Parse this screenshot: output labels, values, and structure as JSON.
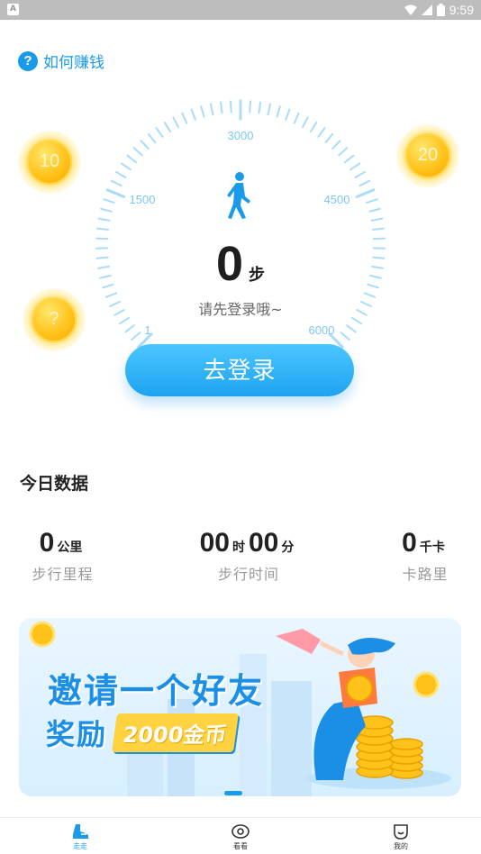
{
  "status_bar": {
    "time": "9:59",
    "notification_icon": "A"
  },
  "help_link": {
    "label": "如何赚钱",
    "icon": "question-icon"
  },
  "coins": [
    {
      "value": "10"
    },
    {
      "value": "20"
    },
    {
      "value": "?"
    }
  ],
  "dial": {
    "tick_labels": [
      "1",
      "1500",
      "3000",
      "4500",
      "6000"
    ],
    "steps": "0",
    "steps_unit": "步",
    "tip": "请先登录哦~",
    "accent_color": "#1a9bea"
  },
  "login_button": {
    "label": "去登录"
  },
  "today": {
    "title": "今日数据",
    "distance": {
      "value": "0",
      "unit": "公里",
      "label": "步行里程"
    },
    "time": {
      "hours": "00",
      "hours_unit": "时",
      "minutes": "00",
      "minutes_unit": "分",
      "label": "步行时间"
    },
    "calories": {
      "value": "0",
      "unit": "千卡",
      "label": "卡路里"
    }
  },
  "banner": {
    "line1": "邀请一个好友",
    "line2_prefix": "奖励",
    "line2_amount": "2000金币"
  },
  "tabs": [
    {
      "label": "走走",
      "icon": "shoe-icon",
      "active": true
    },
    {
      "label": "看看",
      "icon": "eye-icon",
      "active": false
    },
    {
      "label": "我的",
      "icon": "profile-icon",
      "active": false
    }
  ]
}
